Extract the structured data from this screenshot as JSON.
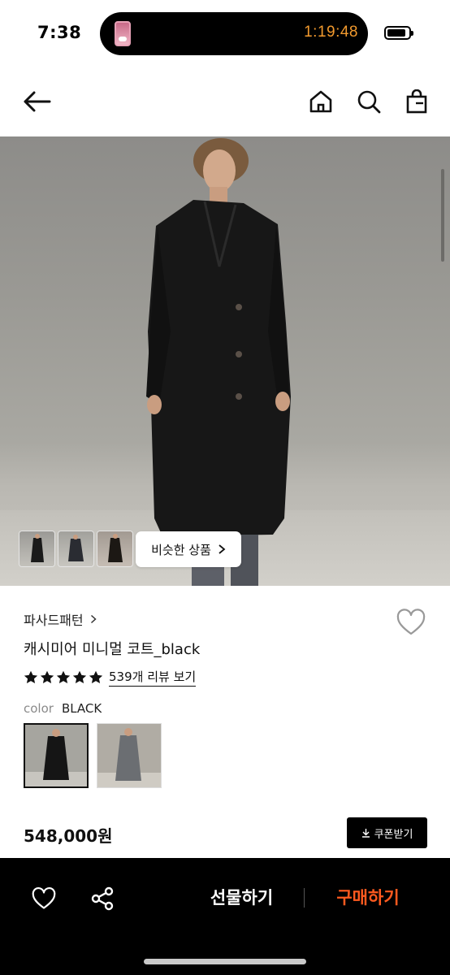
{
  "status_bar": {
    "time": "7:38",
    "live_activity_timer": "1:19:48",
    "timer_color": "#f29a2e"
  },
  "nav": {
    "icons": [
      "back-arrow-icon",
      "home-icon",
      "search-icon",
      "shopping-bag-icon"
    ]
  },
  "hero": {
    "similar_products_label": "비슷한 상품",
    "thumbnail_count": 3
  },
  "product": {
    "brand": "파사드패턴",
    "name": "캐시미어 미니멀 코트_black",
    "rating_stars": 5,
    "review_link": "539개 리뷰 보기",
    "color_label": "color",
    "color_value": "BLACK",
    "price": "548,000원",
    "coupon_label": "쿠폰받기"
  },
  "bottom_bar": {
    "gift_label": "선물하기",
    "buy_label": "구매하기",
    "buy_color": "#ff5a1f",
    "icons": [
      "heart-icon",
      "share-icon"
    ]
  }
}
